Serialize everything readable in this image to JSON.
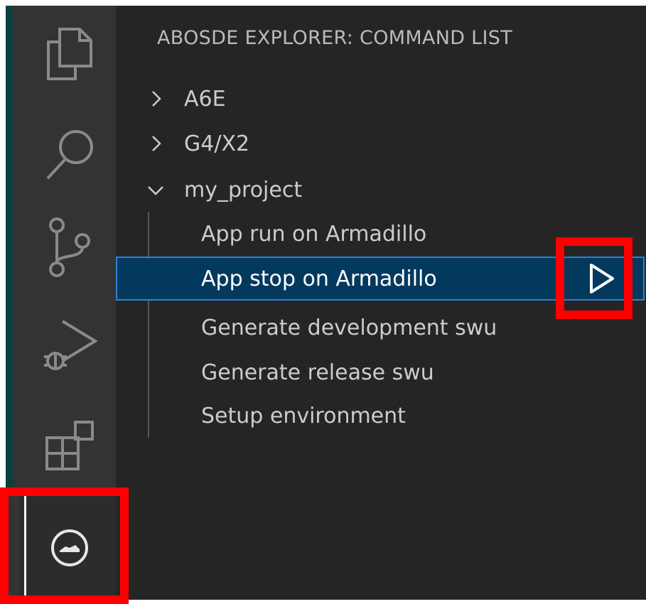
{
  "sidebar": {
    "title": "ABOSDE EXPLORER: COMMAND LIST",
    "folders": [
      {
        "label": "A6E",
        "expanded": false
      },
      {
        "label": "G4/X2",
        "expanded": false
      },
      {
        "label": "my_project",
        "expanded": true
      }
    ],
    "commands": [
      {
        "label": "App run on Armadillo",
        "selected": false
      },
      {
        "label": "App stop on Armadillo",
        "selected": true
      },
      {
        "label": "Generate development swu",
        "selected": false
      },
      {
        "label": "Generate release swu",
        "selected": false
      },
      {
        "label": "Setup environment",
        "selected": false
      }
    ]
  },
  "activity_bar": {
    "items": [
      {
        "icon": "explorer-files-icon"
      },
      {
        "icon": "search-icon"
      },
      {
        "icon": "source-control-icon"
      },
      {
        "icon": "run-debug-icon"
      },
      {
        "icon": "extensions-icon"
      },
      {
        "icon": "abosde-extension-icon",
        "active": true
      }
    ]
  },
  "colors": {
    "activity_bar_bg": "#333333",
    "sidebar_bg": "#252526",
    "selection_bg": "#04395e",
    "selection_border": "#2f7fd4",
    "highlight": "#ff0000"
  }
}
